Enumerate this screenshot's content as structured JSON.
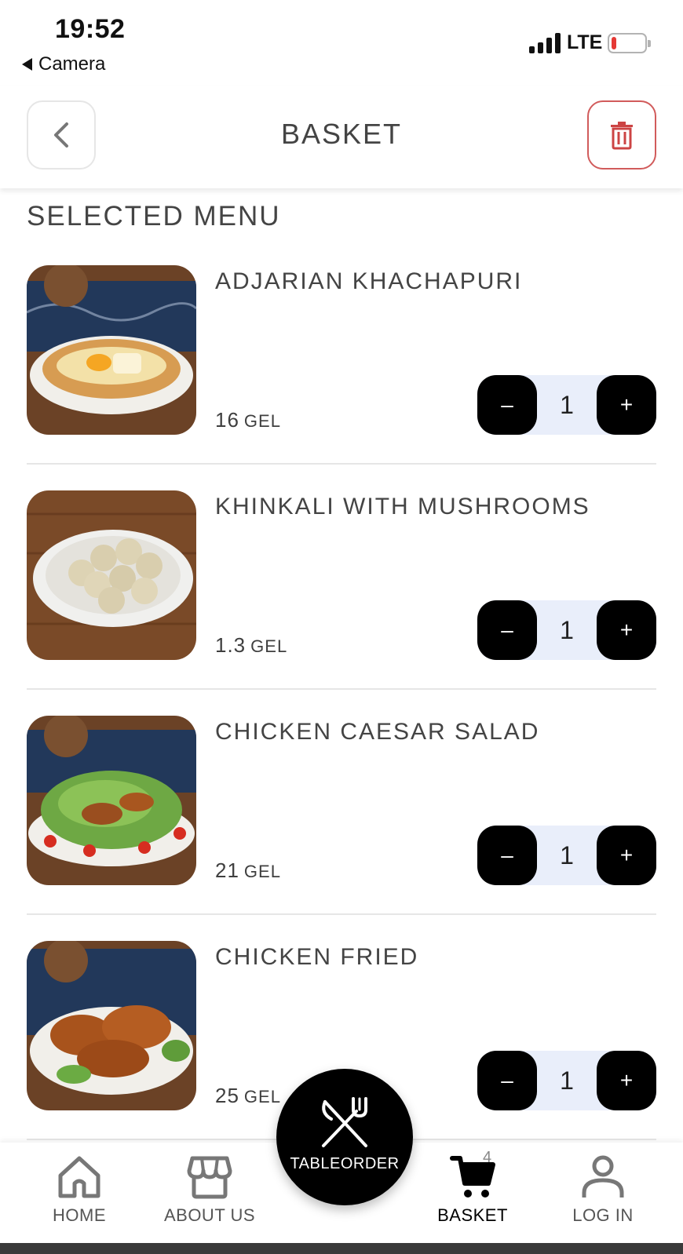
{
  "status_bar": {
    "time": "19:52",
    "back_app": "Camera",
    "network": "LTE"
  },
  "header": {
    "title": "BASKET",
    "back_icon": "chevron-left-icon",
    "trash_icon": "trash-icon"
  },
  "section_title": "SELECTED MENU",
  "items": [
    {
      "name": "ADJARIAN KHACHAPURI",
      "price": "16",
      "currency": "GEL",
      "qty": "1",
      "minus": "–",
      "plus": "+"
    },
    {
      "name": "KHINKALI WITH MUSHROOMS",
      "price": "1.3",
      "currency": "GEL",
      "qty": "1",
      "minus": "–",
      "plus": "+"
    },
    {
      "name": "CHICKEN CAESAR SALAD",
      "price": "21",
      "currency": "GEL",
      "qty": "1",
      "minus": "–",
      "plus": "+"
    },
    {
      "name": "CHICKEN FRIED",
      "price": "25",
      "currency": "GEL",
      "qty": "1",
      "minus": "–",
      "plus": "+"
    }
  ],
  "nav": {
    "home": "HOME",
    "about": "ABOUT US",
    "center": "TABLEORDER",
    "basket": "BASKET",
    "basket_badge": "4",
    "login": "LOG IN"
  },
  "colors": {
    "accent_red": "#d15b5b",
    "stepper_bg": "#e9eefa",
    "button_black": "#000000"
  }
}
